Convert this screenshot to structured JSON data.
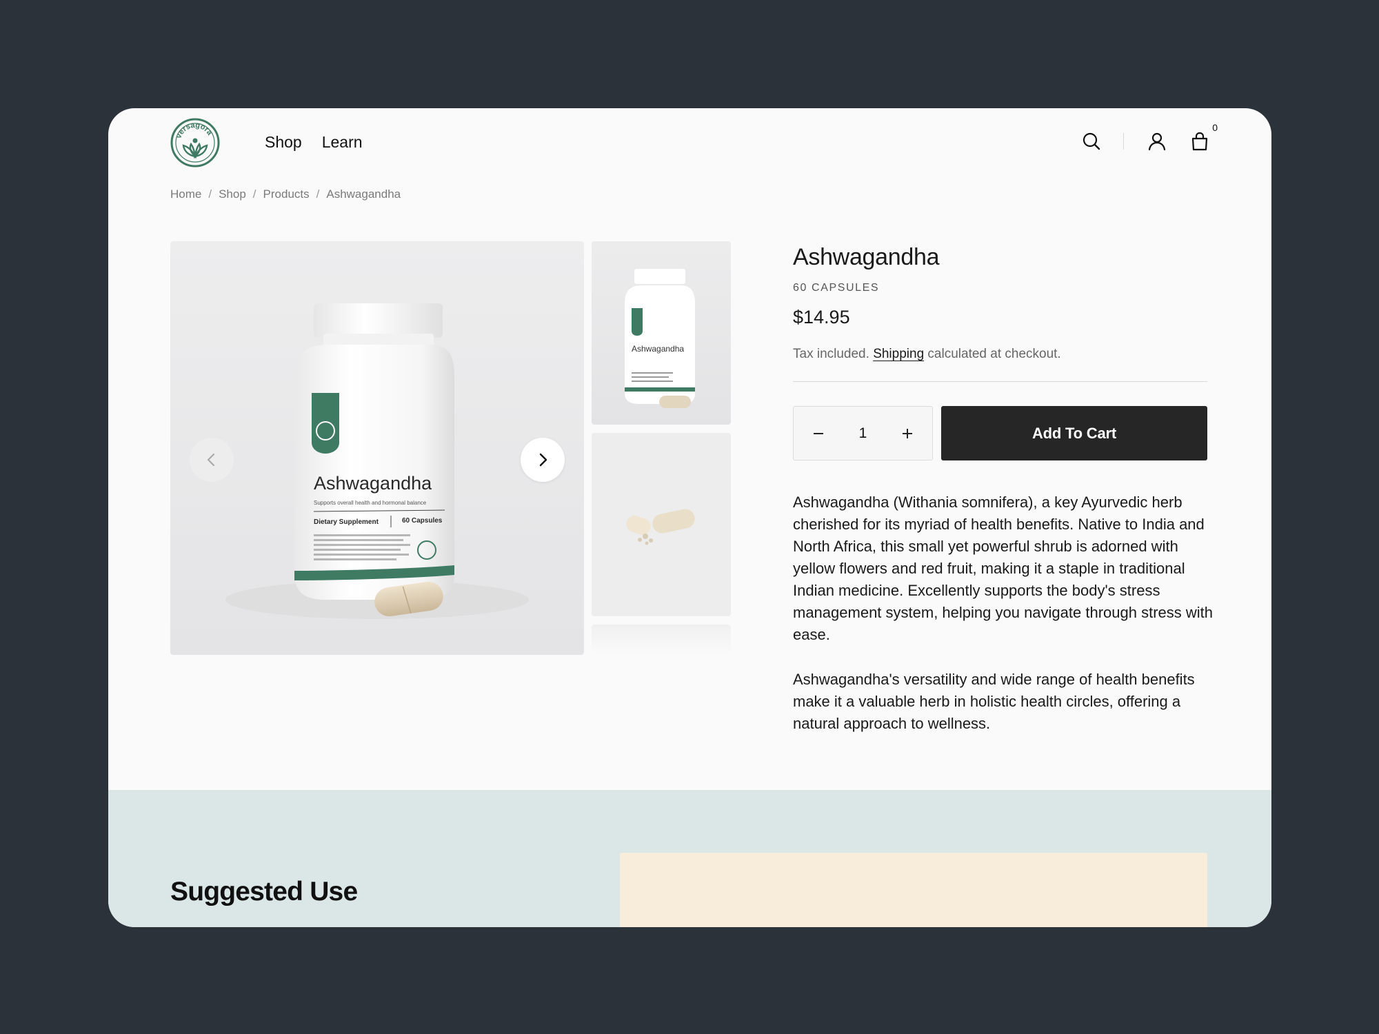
{
  "header": {
    "logo_text": "versagora",
    "nav": [
      {
        "label": "Shop"
      },
      {
        "label": "Learn"
      }
    ],
    "cart_count": "0"
  },
  "breadcrumb": [
    "Home",
    "Shop",
    "Products",
    "Ashwagandha"
  ],
  "gallery": {
    "bottle_name": "Ashwagandha",
    "bottle_tagline": "Supports overall health and hormonal balance",
    "bottle_type": "Dietary Supplement",
    "bottle_count": "60 Capsules",
    "bottle_copy": "Ashwagandha, scientifically known as Withania somnifera, is an adaptogenic herb traditionally used in Ayurvedic medicine, reputed for its potential to reduce stress, improve cognitive function, and enhance overall well-being."
  },
  "product": {
    "title": "Ashwagandha",
    "subtitle": "60 CAPSULES",
    "price": "$14.95",
    "tax_prefix": "Tax included.",
    "shipping_link": "Shipping",
    "tax_suffix": "calculated at checkout.",
    "quantity": "1",
    "add_to_cart": "Add To Cart",
    "description_1": "Ashwagandha (Withania somnifera), a key Ayurvedic herb cherished for its myriad of health benefits. Native to India and North Africa, this small yet powerful shrub is adorned with yellow flowers and red fruit, making it a staple in traditional Indian medicine. Excellently supports the body's stress management system, helping you navigate through stress with ease.",
    "description_2": "Ashwagandha's versatility and wide range of health benefits make it a valuable herb in holistic health circles, offering a natural approach to wellness."
  },
  "suggested": {
    "title": "Suggested Use"
  },
  "colors": {
    "brand_green": "#3f7a63",
    "page_bg": "#2b323a",
    "button_dark": "#262626",
    "section_teal": "#dbe6e7",
    "card_cream": "#f8ecda"
  }
}
